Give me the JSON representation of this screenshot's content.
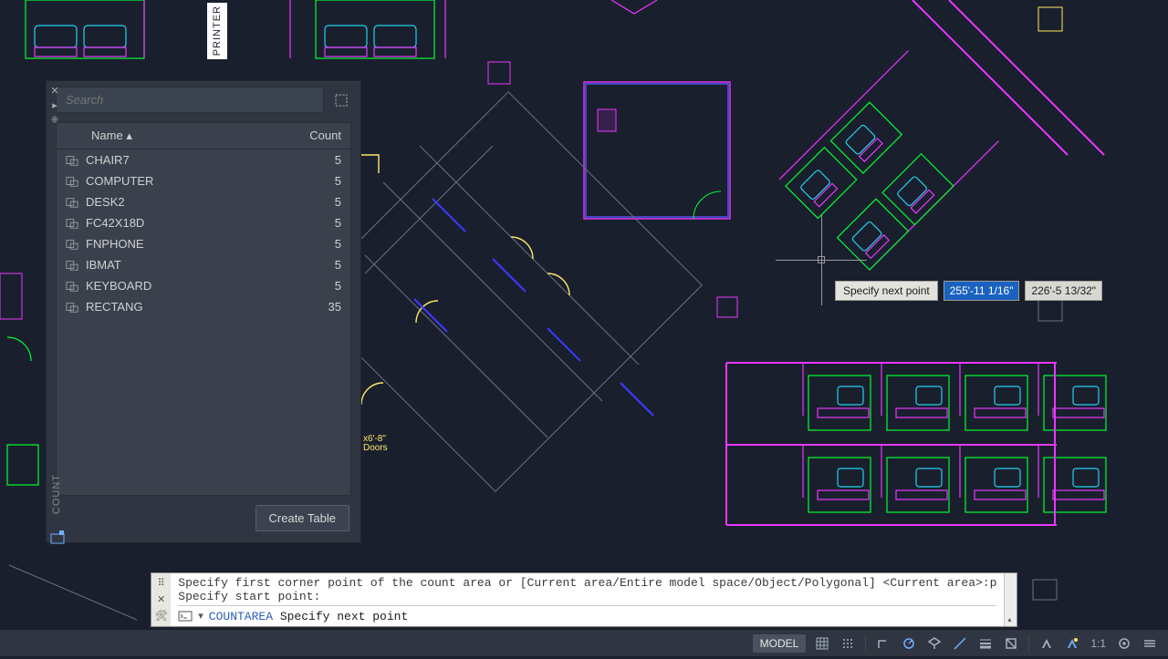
{
  "palette": {
    "title": "COUNT",
    "search_placeholder": "Search",
    "columns": {
      "name": "Name",
      "count": "Count"
    },
    "items": [
      {
        "name": "CHAIR7",
        "count": "5"
      },
      {
        "name": "COMPUTER",
        "count": "5"
      },
      {
        "name": "DESK2",
        "count": "5"
      },
      {
        "name": "FC42X18D",
        "count": "5"
      },
      {
        "name": "FNPHONE",
        "count": "5"
      },
      {
        "name": "IBMAT",
        "count": "5"
      },
      {
        "name": "KEYBOARD",
        "count": "5"
      },
      {
        "name": "RECTANG",
        "count": "35"
      }
    ],
    "create_table_label": "Create Table"
  },
  "printer_label": "PRINTER",
  "doors_label": "x6'-8\"\nDoors",
  "cursor": {
    "prompt": "Specify next point",
    "coord1": "255'-11 1/16\"",
    "coord2": "226'-5 13/32\""
  },
  "command": {
    "history": "Specify first corner point of the count area or [Current area/Entire model space/Object/Polygonal] <Current area>:p\nSpecify start point:",
    "active_command": "COUNTAREA",
    "prompt": "Specify next point"
  },
  "statusbar": {
    "model": "MODEL",
    "ratio": "1:1"
  }
}
